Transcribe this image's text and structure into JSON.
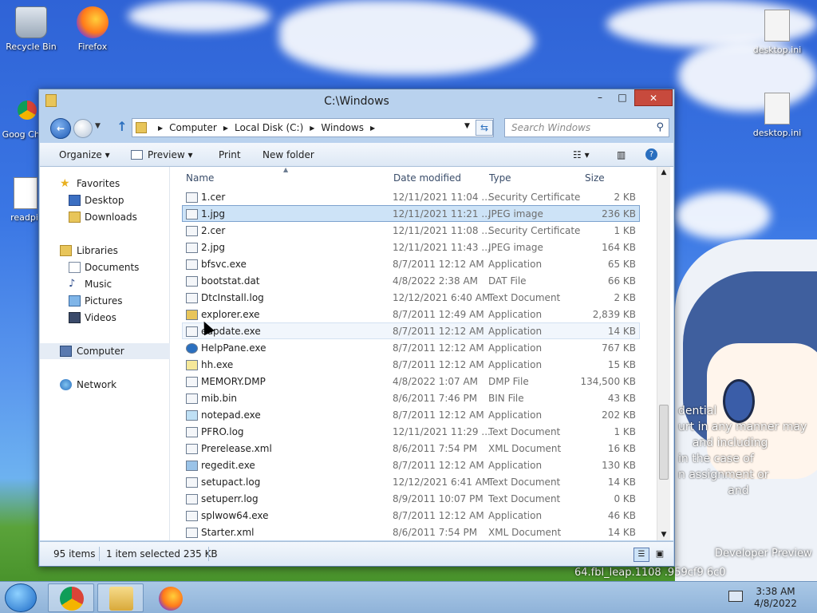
{
  "desktop": {
    "icons": [
      {
        "label": "Recycle Bin",
        "name": "recycle-bin-icon"
      },
      {
        "label": "Firefox",
        "name": "firefox-icon"
      },
      {
        "label": "Goog Chror",
        "name": "chrome-icon"
      },
      {
        "label": "readpil",
        "name": "readme-file-icon"
      },
      {
        "label": "desktop.ini",
        "name": "desktop-ini-icon"
      },
      {
        "label": "desktop.ini",
        "name": "desktop-ini-icon"
      }
    ],
    "wallpaper_text": "dential\nurt in any manner may\n    and including\nin the case of\nn assignment or\n              and",
    "watermark_line1": "Developer Preview",
    "watermark_line2": "64.fbl_leap.1108  .959cf9  6c0"
  },
  "window": {
    "title": "C:\\Windows",
    "controls": {
      "minimize": "–",
      "maximize": "□",
      "close": "✕"
    },
    "breadcrumb": [
      "Computer",
      "Local Disk (C:)",
      "Windows"
    ],
    "search_placeholder": "Search Windows",
    "toolbar": {
      "organize": "Organize ▾",
      "preview": "Preview ▾",
      "print": "Print",
      "new_folder": "New folder"
    },
    "nav": {
      "favorites": "Favorites",
      "desktop": "Desktop",
      "downloads": "Downloads",
      "libraries": "Libraries",
      "documents": "Documents",
      "music": "Music",
      "pictures": "Pictures",
      "videos": "Videos",
      "computer": "Computer",
      "network": "Network"
    },
    "columns": {
      "name": "Name",
      "date": "Date modified",
      "type": "Type",
      "size": "Size"
    },
    "files": [
      {
        "name": "1.cer",
        "date": "12/11/2021 11:04 ...",
        "type": "Security Certificate",
        "size": "2 KB"
      },
      {
        "name": "1.jpg",
        "date": "12/11/2021 11:21 ...",
        "type": "JPEG image",
        "size": "236 KB"
      },
      {
        "name": "2.cer",
        "date": "12/11/2021 11:08 ...",
        "type": "Security Certificate",
        "size": "1 KB"
      },
      {
        "name": "2.jpg",
        "date": "12/11/2021 11:43 ...",
        "type": "JPEG image",
        "size": "164 KB"
      },
      {
        "name": "bfsvc.exe",
        "date": "8/7/2011 12:12 AM",
        "type": "Application",
        "size": "65 KB"
      },
      {
        "name": "bootstat.dat",
        "date": "4/8/2022 2:38 AM",
        "type": "DAT File",
        "size": "66 KB"
      },
      {
        "name": "DtcInstall.log",
        "date": "12/12/2021 6:40 AM",
        "type": "Text Document",
        "size": "2 KB"
      },
      {
        "name": "explorer.exe",
        "date": "8/7/2011 12:49 AM",
        "type": "Application",
        "size": "2,839 KB"
      },
      {
        "name": "eupdate.exe",
        "date": "8/7/2011 12:12 AM",
        "type": "Application",
        "size": "14 KB"
      },
      {
        "name": "HelpPane.exe",
        "date": "8/7/2011 12:12 AM",
        "type": "Application",
        "size": "767 KB"
      },
      {
        "name": "hh.exe",
        "date": "8/7/2011 12:12 AM",
        "type": "Application",
        "size": "15 KB"
      },
      {
        "name": "MEMORY.DMP",
        "date": "4/8/2022 1:07 AM",
        "type": "DMP File",
        "size": "134,500 KB"
      },
      {
        "name": "mib.bin",
        "date": "8/6/2011 7:46 PM",
        "type": "BIN File",
        "size": "43 KB"
      },
      {
        "name": "notepad.exe",
        "date": "8/7/2011 12:12 AM",
        "type": "Application",
        "size": "202 KB"
      },
      {
        "name": "PFRO.log",
        "date": "12/11/2021 11:29 ...",
        "type": "Text Document",
        "size": "1 KB"
      },
      {
        "name": "Prerelease.xml",
        "date": "8/6/2011 7:54 PM",
        "type": "XML Document",
        "size": "16 KB"
      },
      {
        "name": "regedit.exe",
        "date": "8/7/2011 12:12 AM",
        "type": "Application",
        "size": "130 KB"
      },
      {
        "name": "setupact.log",
        "date": "12/12/2021 6:41 AM",
        "type": "Text Document",
        "size": "14 KB"
      },
      {
        "name": "setuperr.log",
        "date": "8/9/2011 10:07 PM",
        "type": "Text Document",
        "size": "0 KB"
      },
      {
        "name": "splwow64.exe",
        "date": "8/7/2011 12:12 AM",
        "type": "Application",
        "size": "46 KB"
      },
      {
        "name": "Starter.xml",
        "date": "8/6/2011 7:54 PM",
        "type": "XML Document",
        "size": "14 KB"
      }
    ],
    "status": {
      "count": "95 items",
      "selection": "1 item selected  235 KB"
    }
  },
  "taskbar": {
    "time": "3:38 AM",
    "date": "4/8/2022"
  }
}
